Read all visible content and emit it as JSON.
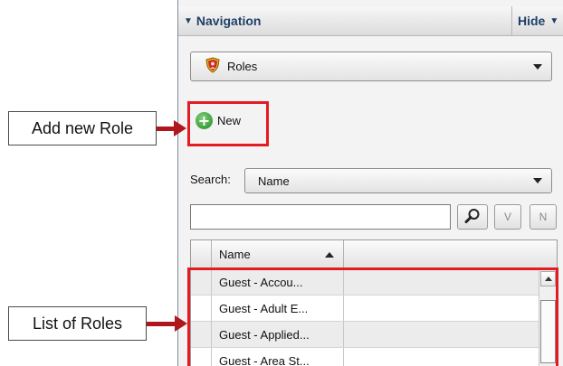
{
  "navigation": {
    "title": "Navigation",
    "hide_label": "Hide"
  },
  "module_select": {
    "selected": "Roles",
    "icon": "shield-icon"
  },
  "toolbar": {
    "new_label": "New",
    "new_icon": "add-circle-icon"
  },
  "search": {
    "label": "Search:",
    "field_selected": "Name",
    "query": "",
    "search_icon": "magnifier-icon",
    "v_label": "V",
    "n_label": "N"
  },
  "grid": {
    "columns": [
      "Name"
    ],
    "sort": "ascending",
    "rows": [
      "Guest - Accou...",
      "Guest - Adult E...",
      "Guest - Applied...",
      "Guest - Area St..."
    ]
  },
  "annotations": {
    "add_new_role": "Add new Role",
    "list_of_roles": "List of Roles",
    "highlight_color": "#e31b23",
    "arrow_color": "#b0171c"
  }
}
